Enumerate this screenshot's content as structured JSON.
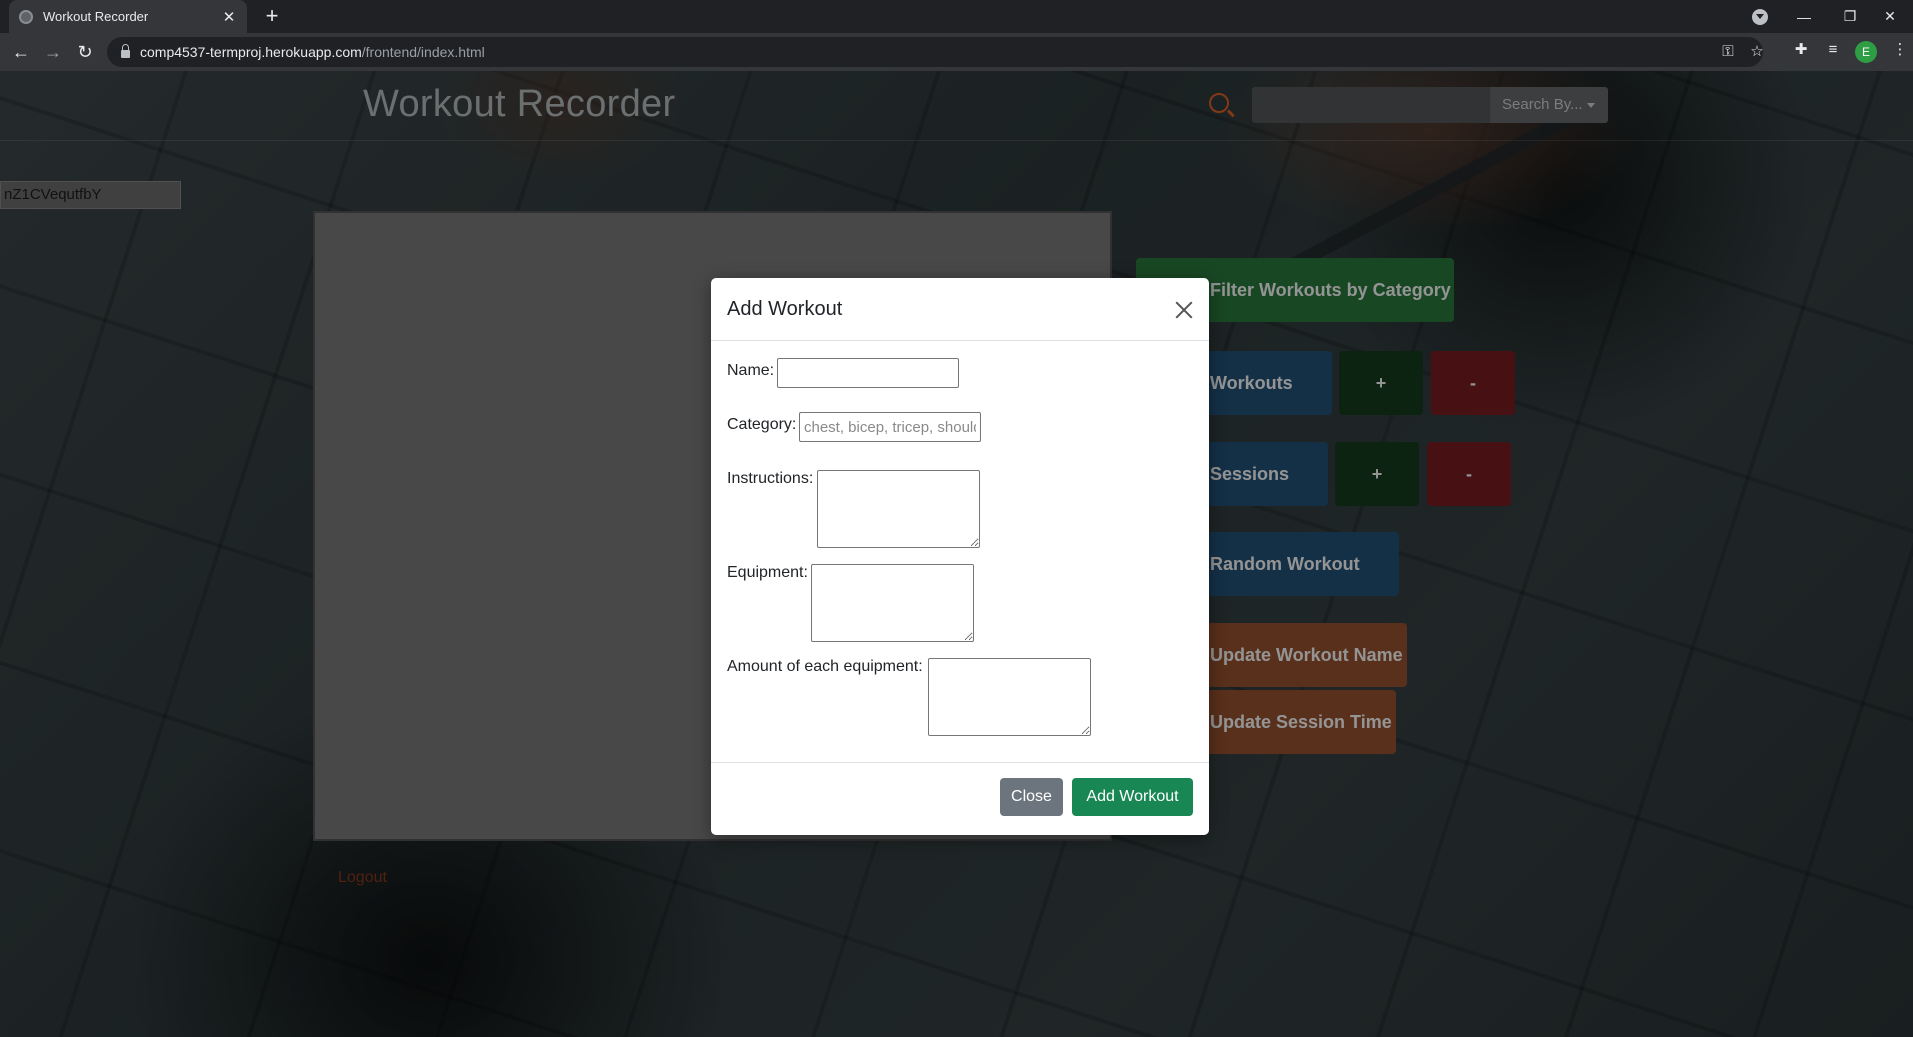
{
  "browser": {
    "tab_title": "Workout Recorder",
    "url_host": "comp4537-termproj.herokuapp.com",
    "url_path": "/frontend/index.html",
    "profile_initial": "E"
  },
  "header": {
    "title": "Workout Recorder",
    "search_placeholder": "",
    "search_by_label": "Search By..."
  },
  "user_token": "nZ1CVequtfbY",
  "logout_label": "Logout",
  "actions": {
    "filter_category": "Filter Workouts by Category",
    "workouts": "Workouts",
    "workouts_add": "+",
    "workouts_remove": "-",
    "sessions": "Sessions",
    "sessions_add": "+",
    "sessions_remove": "-",
    "random_workout": "Random Workout",
    "update_workout_name": "Update Workout Name",
    "update_session_time": "Update Session Time"
  },
  "modal": {
    "title": "Add Workout",
    "fields": {
      "name_label": "Name:",
      "name_value": "",
      "category_label": "Category:",
      "category_placeholder": "chest, bicep, tricep, shoulder",
      "instructions_label": "Instructions:",
      "equipment_label": "Equipment:",
      "amount_label": "Amount of each equipment:"
    },
    "close_label": "Close",
    "submit_label": "Add Workout"
  },
  "colors": {
    "accent_orange": "#e0622a",
    "btn_success": "#198754",
    "btn_secondary": "#6c757d"
  }
}
